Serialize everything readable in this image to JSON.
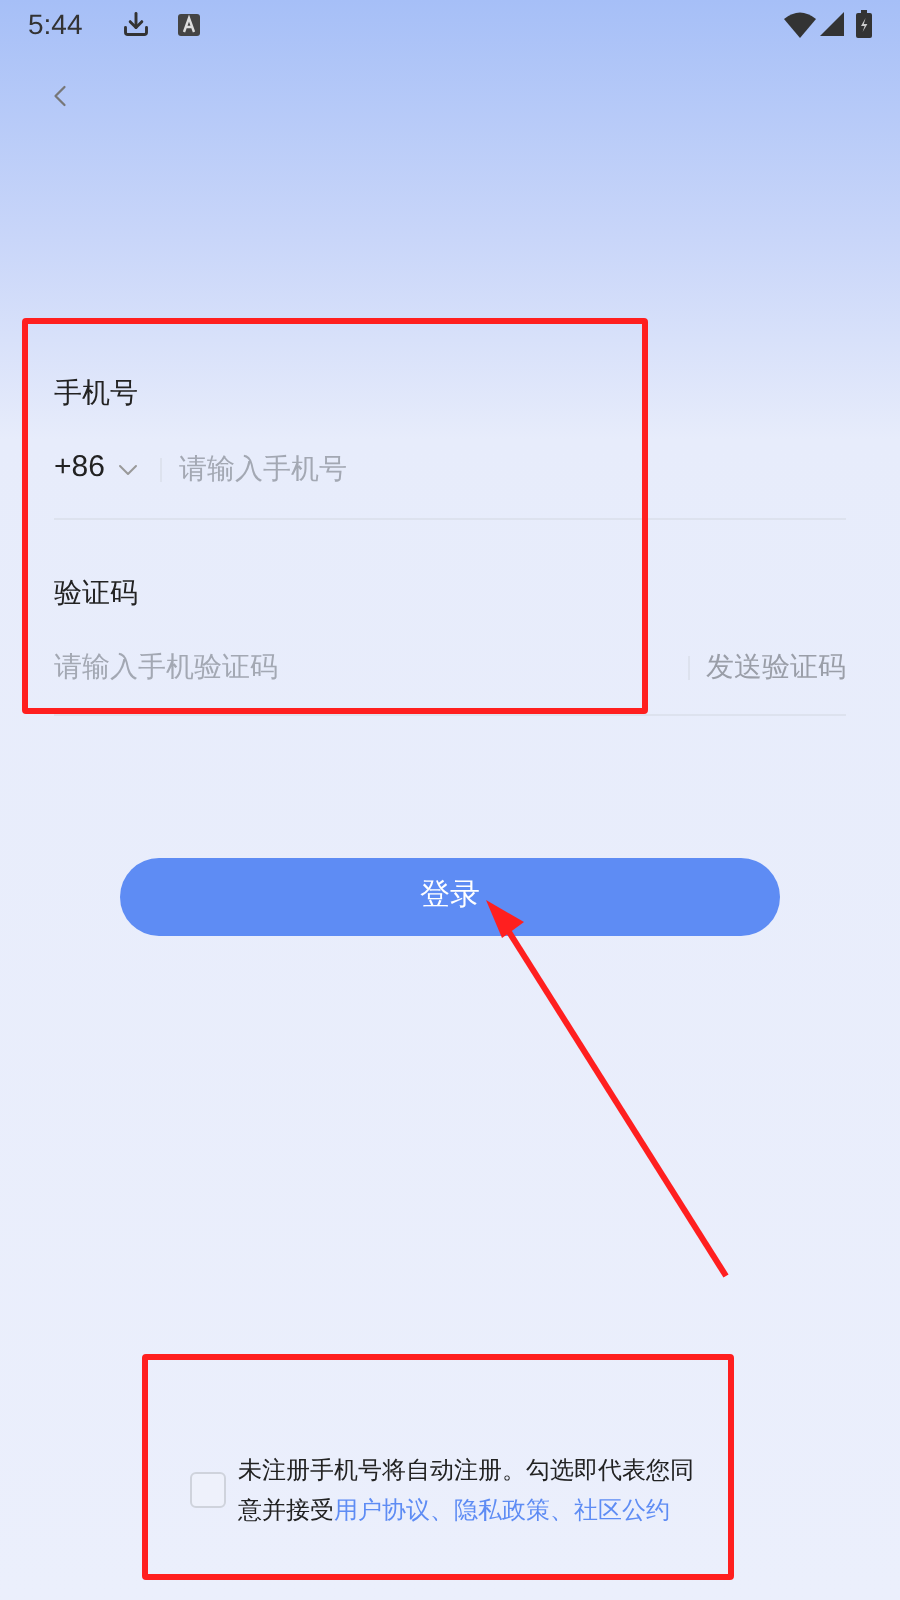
{
  "status_bar": {
    "time": "5:44"
  },
  "phone": {
    "label": "手机号",
    "country_code": "+86",
    "placeholder": "请输入手机号"
  },
  "code": {
    "label": "验证码",
    "placeholder": "请输入手机验证码",
    "send_button": "发送验证码"
  },
  "login_button": "登录",
  "agreement": {
    "checked": false,
    "text": "未注册手机号将自动注册。勾选即代表您同意并接受",
    "separator": "、",
    "links": [
      "用户协议",
      "隐私政策",
      "社区公约"
    ]
  }
}
